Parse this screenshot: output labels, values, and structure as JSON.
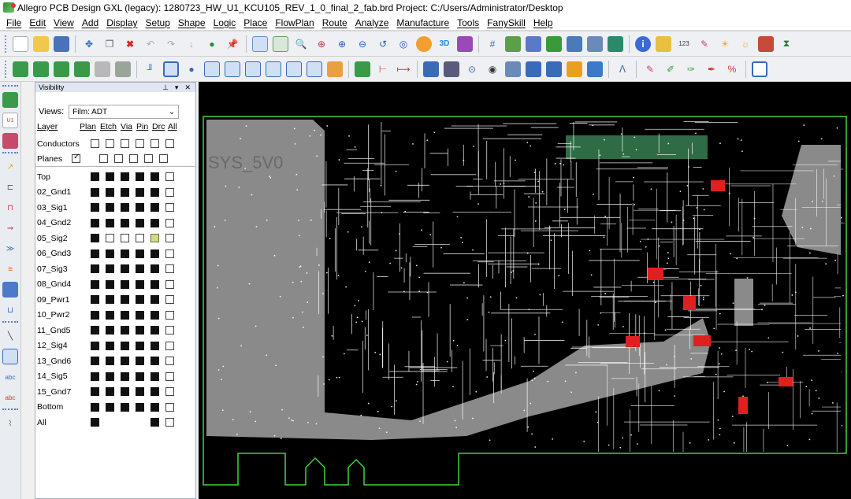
{
  "window": {
    "title": "Allegro PCB Design GXL (legacy): 1280723_HW_U1_KCU105_REV_1_0_final_2_fab.brd  Project: C:/Users/Administrator/Desktop"
  },
  "menu": [
    "File",
    "Edit",
    "View",
    "Add",
    "Display",
    "Setup",
    "Shape",
    "Logic",
    "Place",
    "FlowPlan",
    "Route",
    "Analyze",
    "Manufacture",
    "Tools",
    "FanySkill",
    "Help"
  ],
  "visibility": {
    "title": "Visibility",
    "views_label": "Views:",
    "views_value": "Film: ADT",
    "layer_header": "Layer",
    "columns": [
      "Plan",
      "Etch",
      "Via",
      "Pin",
      "Drc",
      "All"
    ],
    "conductors": "Conductors",
    "planes": "Planes",
    "layers": [
      {
        "name": "Top",
        "states": [
          "on",
          "on",
          "on",
          "on",
          "on",
          "off"
        ]
      },
      {
        "name": "02_Gnd1",
        "states": [
          "on",
          "on",
          "on",
          "on",
          "on",
          "off"
        ]
      },
      {
        "name": "03_Sig1",
        "states": [
          "on",
          "on",
          "on",
          "on",
          "on",
          "off"
        ]
      },
      {
        "name": "04_Gnd2",
        "states": [
          "on",
          "on",
          "on",
          "on",
          "on",
          "off"
        ]
      },
      {
        "name": "05_Sig2",
        "states": [
          "on",
          "off",
          "off",
          "off",
          "y",
          "off"
        ]
      },
      {
        "name": "06_Gnd3",
        "states": [
          "on",
          "on",
          "on",
          "on",
          "on",
          "off"
        ]
      },
      {
        "name": "07_Sig3",
        "states": [
          "on",
          "on",
          "on",
          "on",
          "on",
          "off"
        ]
      },
      {
        "name": "08_Gnd4",
        "states": [
          "on",
          "on",
          "on",
          "on",
          "on",
          "off"
        ]
      },
      {
        "name": "09_Pwr1",
        "states": [
          "on",
          "on",
          "on",
          "on",
          "on",
          "off"
        ]
      },
      {
        "name": "10_Pwr2",
        "states": [
          "on",
          "on",
          "on",
          "on",
          "on",
          "off"
        ]
      },
      {
        "name": "11_Gnd5",
        "states": [
          "on",
          "on",
          "on",
          "on",
          "on",
          "off"
        ]
      },
      {
        "name": "12_Sig4",
        "states": [
          "on",
          "on",
          "on",
          "on",
          "on",
          "off"
        ]
      },
      {
        "name": "13_Gnd6",
        "states": [
          "on",
          "on",
          "on",
          "on",
          "on",
          "off"
        ]
      },
      {
        "name": "14_Sig5",
        "states": [
          "on",
          "on",
          "on",
          "on",
          "on",
          "off"
        ]
      },
      {
        "name": "15_Gnd7",
        "states": [
          "on",
          "on",
          "on",
          "on",
          "on",
          "off"
        ]
      },
      {
        "name": "Bottom",
        "states": [
          "on",
          "on",
          "on",
          "on",
          "on",
          "off"
        ]
      },
      {
        "name": "All",
        "states": [
          "on",
          "none",
          "none",
          "none",
          "on",
          "off"
        ]
      }
    ]
  },
  "board": {
    "silk_label": "SYS_5V0"
  },
  "colors": {
    "board_outline": "#3fd63f",
    "etch": "#ffffff",
    "plane": "#8a8a8a",
    "highlight": "#e02020",
    "connector": "#2f6b45"
  }
}
